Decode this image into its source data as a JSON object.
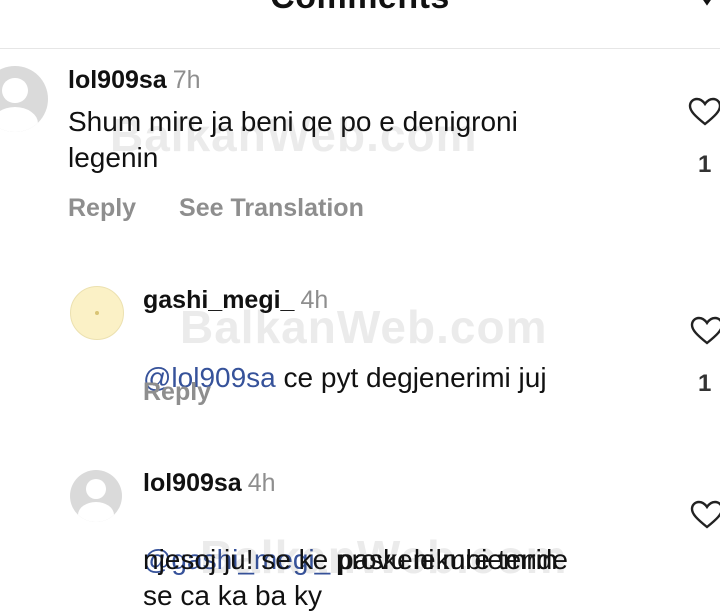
{
  "header": {
    "title": "Comments",
    "chevron_icon": "chevron-down-icon"
  },
  "comments": [
    {
      "username": "lol909sa",
      "time": "7h",
      "text": "Shum mire ja beni qe po e denigroni\nlegenin",
      "reply_label": "Reply",
      "translate_label": "See Translation",
      "likes": "1"
    },
    {
      "username": "gashi_megi_",
      "time": "4h",
      "mention": "@lol909sa",
      "text": " ce pyt degjenerimi juj",
      "reply_label": "Reply",
      "likes": "1"
    },
    {
      "username": "lol909sa",
      "time": "4h",
      "mention": "@gashi_megi_",
      "text_line1": " paskeni mbiemrin",
      "text_rest": "njesoj ju! se ke provu lekure tende\nse ca ka ba ky"
    }
  ],
  "watermark": "BalkanWeb.com",
  "colors": {
    "mention": "#36529a",
    "secondary_text": "#8e8e8e",
    "avatar_default": "#dadada",
    "avatar_yellow": "#fbf1c6"
  }
}
